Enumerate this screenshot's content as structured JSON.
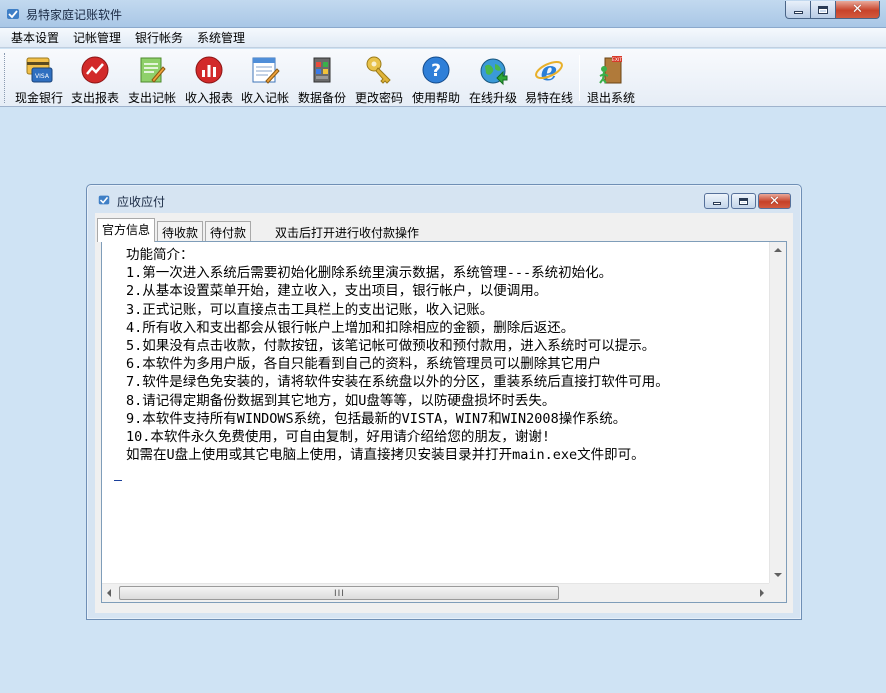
{
  "window": {
    "title": "易特家庭记账软件",
    "icon": "app-icon"
  },
  "menu": {
    "items": [
      "基本设置",
      "记帐管理",
      "银行帐务",
      "系统管理"
    ]
  },
  "toolbar": {
    "buttons": [
      {
        "label": "现金银行",
        "icon": "cash-bank-icon"
      },
      {
        "label": "支出报表",
        "icon": "expense-report-icon"
      },
      {
        "label": "支出记帐",
        "icon": "expense-entry-icon"
      },
      {
        "label": "收入报表",
        "icon": "income-report-icon"
      },
      {
        "label": "收入记帐",
        "icon": "income-entry-icon"
      },
      {
        "label": "数据备份",
        "icon": "data-backup-icon"
      },
      {
        "label": "更改密码",
        "icon": "change-password-icon"
      },
      {
        "label": "使用帮助",
        "icon": "help-icon"
      },
      {
        "label": "在线升级",
        "icon": "online-upgrade-icon"
      },
      {
        "label": "易特在线",
        "icon": "ie-browser-icon"
      },
      {
        "label": "退出系统",
        "icon": "exit-icon"
      }
    ]
  },
  "child_window": {
    "title": "应收应付",
    "tabs": [
      {
        "label": "官方信息",
        "active": true
      },
      {
        "label": "待收款",
        "active": false
      },
      {
        "label": "待付款",
        "active": false
      }
    ],
    "hint": "双击后打开进行收付款操作",
    "content": {
      "lines": [
        "功能简介：",
        "1.第一次进入系统后需要初始化删除系统里演示数据，系统管理---系统初始化。",
        "2.从基本设置菜单开始，建立收入，支出项目，银行帐户，以便调用。",
        "3.正式记账，可以直接点击工具栏上的支出记账，收入记账。",
        "4.所有收入和支出都会从银行帐户上增加和扣除相应的金额，删除后返还。",
        "5.如果没有点击收款，付款按钮，该笔记帐可做预收和预付款用，进入系统时可以提示。",
        "6.本软件为多用户版，各自只能看到自己的资料，系统管理员可以删除其它用户",
        "7.软件是绿色免安装的，请将软件安装在系统盘以外的分区，重装系统后直接打软件可用。",
        "8.请记得定期备份数据到其它地方，如U盘等等，以防硬盘损坏时丢失。",
        "9.本软件支持所有WINDOWS系统，包括最新的VISTA，WIN7和WIN2008操作系统。",
        "10.本软件永久免费使用，可自由复制，好用请介绍给您的朋友，谢谢!",
        "如需在U盘上使用或其它电脑上使用，请直接拷贝安装目录并打开main.exe文件即可。"
      ]
    },
    "scrollbar": {
      "thumb_grip": "III"
    }
  },
  "colors": {
    "desktop": "#cfe3f4",
    "close_button": "#c8432a",
    "caret": "#1a3f9a"
  }
}
